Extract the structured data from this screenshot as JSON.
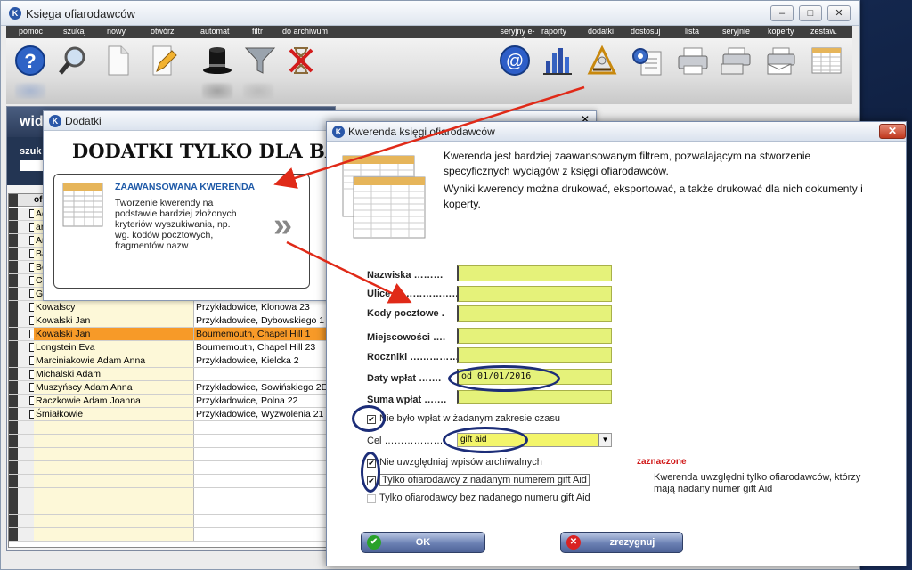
{
  "app": {
    "title": "Księga ofiarodawców"
  },
  "menu": [
    "pomoc",
    "szukaj",
    "nowy",
    "otwórz",
    "automat",
    "filtr",
    "do archiwum",
    "seryjny e-mail",
    "raporty",
    "dodatki",
    "dostosuj",
    "lista",
    "seryjnie",
    "koperty",
    "zestaw."
  ],
  "behind": {
    "title_fragment": "wid",
    "search_label": "szuk",
    "column_header": "ofi"
  },
  "dodatki": {
    "window_title": "Dodatki",
    "heading": "DODATKI TYLKO DLA BARI",
    "card_title": "ZAAWANSOWANA KWERENDA",
    "card_text": [
      "Tworzenie kwerendy na",
      "podstawie bardziej złożonych",
      "kryteriów wyszukiwania, np.",
      "wg. kodów pocztowych,",
      "fragmentów nazw"
    ],
    "chevron": "»"
  },
  "table": {
    "partial_rows": [
      "Ad",
      "ar",
      "Ar",
      "Ba",
      "Be",
      "Ci",
      "Gi"
    ],
    "rows": [
      {
        "name": "Kowalscy",
        "address": "Przykładowice, Klonowa 23",
        "selected": false
      },
      {
        "name": "Kowalski Jan",
        "address": "Przykładowice, Dybowskiego 1",
        "selected": false
      },
      {
        "name": "Kowalski Jan",
        "address": "Bournemouth, Chapel Hill 1",
        "selected": true
      },
      {
        "name": "Longstein Eva",
        "address": "Bournemouth, Chapel Hill 23",
        "selected": false
      },
      {
        "name": "Marciniakowie Adam Anna",
        "address": "Przykładowice, Kielcka 2",
        "selected": false
      },
      {
        "name": "Michalski Adam",
        "address": "",
        "selected": false
      },
      {
        "name": "Muszyńscy Adam Anna",
        "address": "Przykładowice, Sowińskiego 2E",
        "selected": false
      },
      {
        "name": "Raczkowie Adam Joanna",
        "address": "Przykładowice, Polna 22",
        "selected": false
      },
      {
        "name": "Śmiałkowie",
        "address": "Przykładowice, Wyzwolenia 21",
        "selected": false
      }
    ]
  },
  "kwerenda": {
    "title": "Kwerenda księgi ofiarodawców",
    "intro1": "Kwerenda jest bardziej zaawansowanym filtrem, pozwalającym na stworzenie specyficznych wyciągów z księgi ofiarodawców.",
    "intro2": "Wyniki kwerendy można drukować, eksportować, a także drukować dla nich dokumenty i koperty.",
    "fields": [
      {
        "label": "Nazwiska ………",
        "value": ""
      },
      {
        "label": "Ulice …………………",
        "value": ""
      },
      {
        "label": "Kody pocztowe .",
        "value": ""
      },
      {
        "label": "Miejscowości ….",
        "value": ""
      },
      {
        "label": "Roczniki ……………",
        "value": ""
      },
      {
        "label": "Daty wpłat …….",
        "value": "od 01/01/2016"
      },
      {
        "label": "Suma wpłat …….",
        "value": ""
      }
    ],
    "no_payments_label": "Nie było wpłat w żadanym zakresie czasu",
    "no_payments_checked": true,
    "goal_label": "Cel ………………",
    "goal_value": "gift aid",
    "checks": [
      {
        "label": "Nie uwzględniaj wpisów archiwalnych",
        "checked": true
      },
      {
        "label": "Tylko ofiarodawcy z nadanym numerem gift Aid",
        "checked": true
      },
      {
        "label": "Tylko ofiarodawcy bez nadanego numeru gift Aid",
        "checked": false
      }
    ],
    "note_red": "zaznaczone",
    "note_text": "Kwerenda uwzględni tylko ofiarodawców, którzy mają nadany numer gift Aid",
    "ok_label": "OK",
    "cancel_label": "zrezygnuj"
  },
  "colors": {
    "input": "#e5f27a",
    "selected_row": "#f79a28",
    "annotation": "#1c2d78",
    "arrow": "#e02a18",
    "note_red": "#d01818"
  },
  "icons": [
    "help-icon",
    "search-icon",
    "new-document-icon",
    "edit-icon",
    "magic-hat-icon",
    "filter-funnel-icon",
    "archive-icon",
    "email-icon",
    "report-chart-icon",
    "addons-tool-icon",
    "settings-icon",
    "print-icon",
    "print-batch-icon",
    "envelope-print-icon",
    "list-icon"
  ]
}
